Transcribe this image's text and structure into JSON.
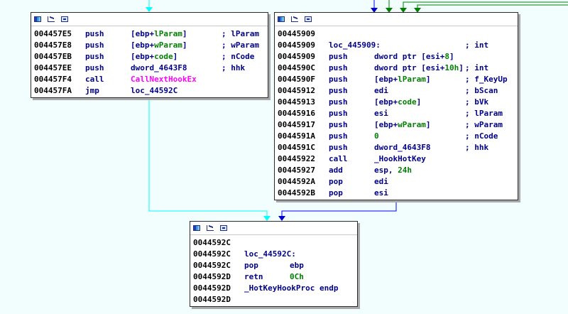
{
  "colors": {
    "background": "#f2fefe",
    "edge_jump": "#00ffff",
    "edge_normal": "#0000ff",
    "edge_true": "#008000",
    "mnemonic": "#00008b",
    "variable": "#008000",
    "external_function": "#ff00ff"
  },
  "toolbar_icons": [
    "color-icon",
    "graph-icon",
    "group-icon"
  ],
  "block_left": {
    "lines": [
      {
        "addr": "004457E5",
        "mn": "push",
        "ops": [
          [
            "[ebp+",
            "op"
          ],
          [
            "lParam",
            "var"
          ],
          [
            "]",
            "op"
          ]
        ],
        "cmt": "; lParam"
      },
      {
        "addr": "004457E8",
        "mn": "push",
        "ops": [
          [
            "[ebp+",
            "op"
          ],
          [
            "wParam",
            "var"
          ],
          [
            "]",
            "op"
          ]
        ],
        "cmt": "; wParam"
      },
      {
        "addr": "004457EB",
        "mn": "push",
        "ops": [
          [
            "[ebp+",
            "op"
          ],
          [
            "code",
            "var"
          ],
          [
            "]",
            "op"
          ]
        ],
        "cmt": "; nCode"
      },
      {
        "addr": "004457EE",
        "mn": "push",
        "ops": [
          [
            "dword_4643F8",
            "op"
          ]
        ],
        "cmt": "; hhk"
      },
      {
        "addr": "004457F4",
        "mn": "call",
        "ops": [
          [
            "CallNextHookEx",
            "ext"
          ]
        ],
        "cmt": ""
      },
      {
        "addr": "004457FA",
        "mn": "jmp",
        "ops": [
          [
            "loc_44592C",
            "op"
          ]
        ],
        "cmt": ""
      }
    ]
  },
  "block_right": {
    "lines": [
      {
        "addr": "00445909",
        "label": "",
        "mn": "",
        "ops": [],
        "cmt": ""
      },
      {
        "addr": "00445909",
        "label": "loc_445909:",
        "mn": "",
        "ops": [],
        "cmt": "; int"
      },
      {
        "addr": "00445909",
        "mn": "push",
        "ops": [
          [
            "dword ptr [esi+",
            "op"
          ],
          [
            "8",
            "num"
          ],
          [
            "]",
            "op"
          ]
        ],
        "cmt": ""
      },
      {
        "addr": "0044590C",
        "mn": "push",
        "ops": [
          [
            "dword ptr [esi+",
            "op"
          ],
          [
            "10h",
            "num"
          ],
          [
            "]",
            "op"
          ]
        ],
        "cmt": "; int"
      },
      {
        "addr": "0044590F",
        "mn": "push",
        "ops": [
          [
            "[ebp+",
            "op"
          ],
          [
            "lParam",
            "var"
          ],
          [
            "]",
            "op"
          ]
        ],
        "cmt": "; f_KeyUp"
      },
      {
        "addr": "00445912",
        "mn": "push",
        "ops": [
          [
            "edi",
            "op"
          ]
        ],
        "cmt": "; bScan"
      },
      {
        "addr": "00445913",
        "mn": "push",
        "ops": [
          [
            "[ebp+",
            "op"
          ],
          [
            "code",
            "var"
          ],
          [
            "]",
            "op"
          ]
        ],
        "cmt": "; bVk"
      },
      {
        "addr": "00445916",
        "mn": "push",
        "ops": [
          [
            "esi",
            "op"
          ]
        ],
        "cmt": "; lParam"
      },
      {
        "addr": "00445917",
        "mn": "push",
        "ops": [
          [
            "[ebp+",
            "op"
          ],
          [
            "wParam",
            "var"
          ],
          [
            "]",
            "op"
          ]
        ],
        "cmt": "; wParam"
      },
      {
        "addr": "0044591A",
        "mn": "push",
        "ops": [
          [
            "0",
            "num"
          ]
        ],
        "cmt": "; nCode"
      },
      {
        "addr": "0044591C",
        "mn": "push",
        "ops": [
          [
            "dword_4643F8",
            "op"
          ]
        ],
        "cmt": "; hhk"
      },
      {
        "addr": "00445922",
        "mn": "call",
        "ops": [
          [
            "_HookHotKey",
            "op"
          ]
        ],
        "cmt": ""
      },
      {
        "addr": "00445927",
        "mn": "add",
        "ops": [
          [
            "esp, ",
            "op"
          ],
          [
            "24h",
            "num"
          ]
        ],
        "cmt": ""
      },
      {
        "addr": "0044592A",
        "mn": "pop",
        "ops": [
          [
            "edi",
            "op"
          ]
        ],
        "cmt": ""
      },
      {
        "addr": "0044592B",
        "mn": "pop",
        "ops": [
          [
            "esi",
            "op"
          ]
        ],
        "cmt": ""
      }
    ]
  },
  "block_bottom": {
    "lines": [
      {
        "addr": "0044592C",
        "label": "",
        "mn": "",
        "ops": [],
        "cmt": ""
      },
      {
        "addr": "0044592C",
        "label": "loc_44592C:",
        "mn": "",
        "ops": [],
        "cmt": ""
      },
      {
        "addr": "0044592C",
        "mn": "pop",
        "ops": [
          [
            "ebp",
            "op"
          ]
        ],
        "cmt": ""
      },
      {
        "addr": "0044592D",
        "mn": "retn",
        "ops": [
          [
            "0Ch",
            "num"
          ]
        ],
        "cmt": ""
      },
      {
        "addr": "0044592D",
        "label": "_HotKeyHookProc endp",
        "mn": "",
        "ops": [],
        "cmt": ""
      },
      {
        "addr": "0044592D",
        "label": "",
        "mn": "",
        "ops": [],
        "cmt": ""
      }
    ]
  }
}
